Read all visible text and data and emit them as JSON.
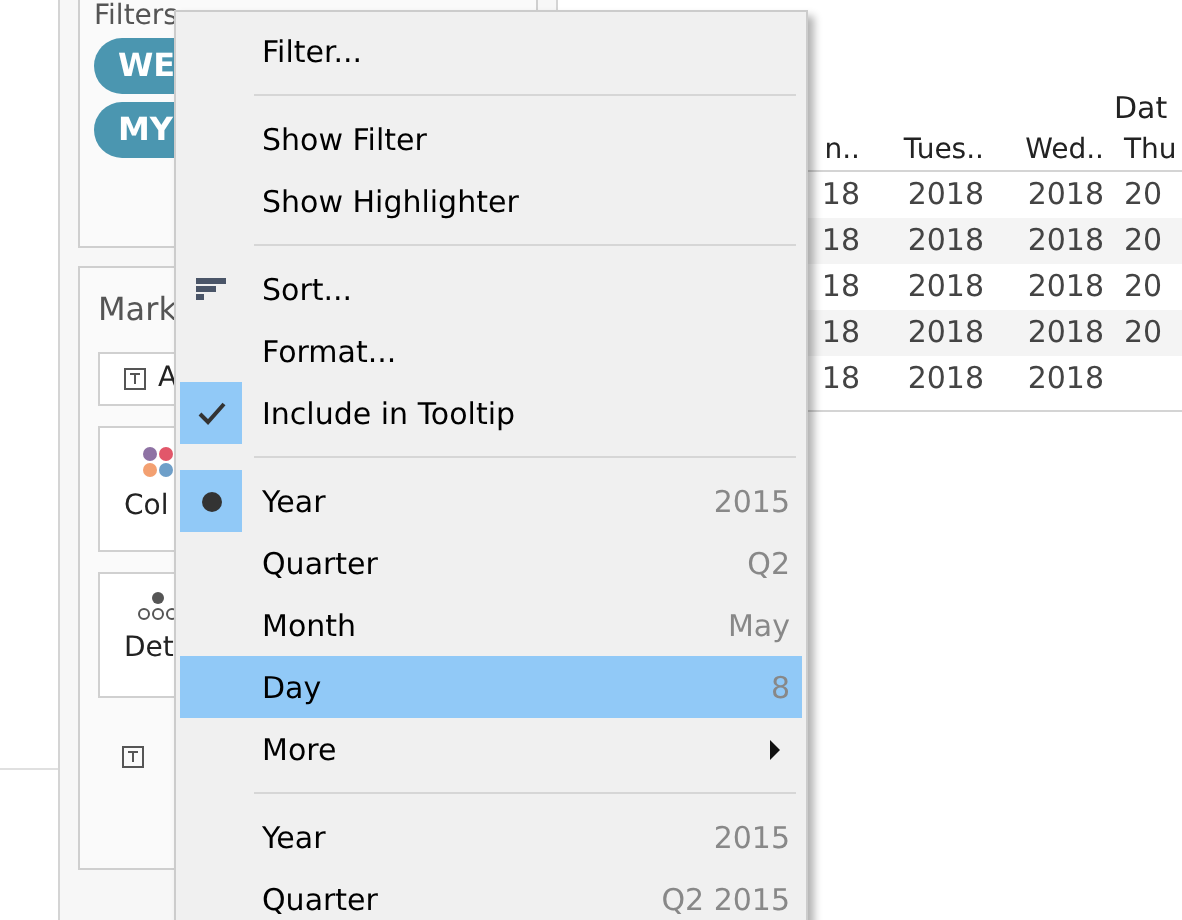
{
  "sidebar": {
    "filters": {
      "title": "Filters",
      "pills": [
        "WE",
        "MY"
      ]
    },
    "marks": {
      "title": "Mark",
      "type_field": "A",
      "cards": [
        {
          "kind": "color",
          "label": "Col"
        },
        {
          "kind": "detail",
          "label": "Det"
        }
      ]
    }
  },
  "table": {
    "header_group": "Dat",
    "columns": [
      "n..",
      "Tues..",
      "Wed..",
      "Thu"
    ],
    "rows": [
      [
        "18",
        "2018",
        "2018",
        "20"
      ],
      [
        "18",
        "2018",
        "2018",
        "20"
      ],
      [
        "18",
        "2018",
        "2018",
        "20"
      ],
      [
        "18",
        "2018",
        "2018",
        "20"
      ],
      [
        "18",
        "2018",
        "2018"
      ]
    ]
  },
  "context_menu": {
    "items": [
      {
        "kind": "item",
        "label": "Filter...",
        "hovered": false
      },
      {
        "kind": "separator"
      },
      {
        "kind": "item",
        "label": "Show Filter",
        "hovered": false
      },
      {
        "kind": "item",
        "label": "Show Highlighter",
        "hovered": false
      },
      {
        "kind": "separator"
      },
      {
        "kind": "sort",
        "label": "Sort...",
        "hovered": false
      },
      {
        "kind": "item",
        "label": "Format...",
        "hovered": false
      },
      {
        "kind": "check",
        "label": "Include in Tooltip",
        "checked": true,
        "hovered": false
      },
      {
        "kind": "separator"
      },
      {
        "kind": "radio",
        "label": "Year",
        "value": "2015",
        "selected": true,
        "hovered": false
      },
      {
        "kind": "radio",
        "label": "Quarter",
        "value": "Q2",
        "selected": false,
        "hovered": false
      },
      {
        "kind": "radio",
        "label": "Month",
        "value": "May",
        "selected": false,
        "hovered": false
      },
      {
        "kind": "radio",
        "label": "Day",
        "value": "8",
        "selected": false,
        "hovered": true
      },
      {
        "kind": "submenu",
        "label": "More",
        "hovered": false
      },
      {
        "kind": "separator"
      },
      {
        "kind": "radio",
        "label": "Year",
        "value": "2015",
        "selected": false,
        "hovered": false
      },
      {
        "kind": "radio",
        "label": "Quarter",
        "value": "Q2 2015",
        "selected": false,
        "hovered": false
      }
    ]
  }
}
